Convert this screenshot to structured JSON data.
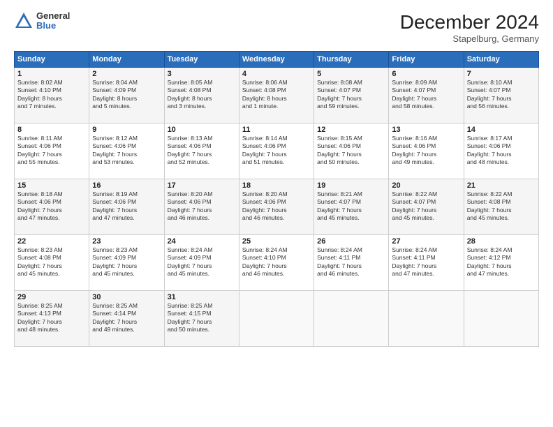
{
  "header": {
    "logo_general": "General",
    "logo_blue": "Blue",
    "title": "December 2024",
    "location": "Stapelburg, Germany"
  },
  "days_of_week": [
    "Sunday",
    "Monday",
    "Tuesday",
    "Wednesday",
    "Thursday",
    "Friday",
    "Saturday"
  ],
  "weeks": [
    [
      {
        "day": "1",
        "detail": "Sunrise: 8:02 AM\nSunset: 4:10 PM\nDaylight: 8 hours\nand 7 minutes."
      },
      {
        "day": "2",
        "detail": "Sunrise: 8:04 AM\nSunset: 4:09 PM\nDaylight: 8 hours\nand 5 minutes."
      },
      {
        "day": "3",
        "detail": "Sunrise: 8:05 AM\nSunset: 4:08 PM\nDaylight: 8 hours\nand 3 minutes."
      },
      {
        "day": "4",
        "detail": "Sunrise: 8:06 AM\nSunset: 4:08 PM\nDaylight: 8 hours\nand 1 minute."
      },
      {
        "day": "5",
        "detail": "Sunrise: 8:08 AM\nSunset: 4:07 PM\nDaylight: 7 hours\nand 59 minutes."
      },
      {
        "day": "6",
        "detail": "Sunrise: 8:09 AM\nSunset: 4:07 PM\nDaylight: 7 hours\nand 58 minutes."
      },
      {
        "day": "7",
        "detail": "Sunrise: 8:10 AM\nSunset: 4:07 PM\nDaylight: 7 hours\nand 56 minutes."
      }
    ],
    [
      {
        "day": "8",
        "detail": "Sunrise: 8:11 AM\nSunset: 4:06 PM\nDaylight: 7 hours\nand 55 minutes."
      },
      {
        "day": "9",
        "detail": "Sunrise: 8:12 AM\nSunset: 4:06 PM\nDaylight: 7 hours\nand 53 minutes."
      },
      {
        "day": "10",
        "detail": "Sunrise: 8:13 AM\nSunset: 4:06 PM\nDaylight: 7 hours\nand 52 minutes."
      },
      {
        "day": "11",
        "detail": "Sunrise: 8:14 AM\nSunset: 4:06 PM\nDaylight: 7 hours\nand 51 minutes."
      },
      {
        "day": "12",
        "detail": "Sunrise: 8:15 AM\nSunset: 4:06 PM\nDaylight: 7 hours\nand 50 minutes."
      },
      {
        "day": "13",
        "detail": "Sunrise: 8:16 AM\nSunset: 4:06 PM\nDaylight: 7 hours\nand 49 minutes."
      },
      {
        "day": "14",
        "detail": "Sunrise: 8:17 AM\nSunset: 4:06 PM\nDaylight: 7 hours\nand 48 minutes."
      }
    ],
    [
      {
        "day": "15",
        "detail": "Sunrise: 8:18 AM\nSunset: 4:06 PM\nDaylight: 7 hours\nand 47 minutes."
      },
      {
        "day": "16",
        "detail": "Sunrise: 8:19 AM\nSunset: 4:06 PM\nDaylight: 7 hours\nand 47 minutes."
      },
      {
        "day": "17",
        "detail": "Sunrise: 8:20 AM\nSunset: 4:06 PM\nDaylight: 7 hours\nand 46 minutes."
      },
      {
        "day": "18",
        "detail": "Sunrise: 8:20 AM\nSunset: 4:06 PM\nDaylight: 7 hours\nand 46 minutes."
      },
      {
        "day": "19",
        "detail": "Sunrise: 8:21 AM\nSunset: 4:07 PM\nDaylight: 7 hours\nand 45 minutes."
      },
      {
        "day": "20",
        "detail": "Sunrise: 8:22 AM\nSunset: 4:07 PM\nDaylight: 7 hours\nand 45 minutes."
      },
      {
        "day": "21",
        "detail": "Sunrise: 8:22 AM\nSunset: 4:08 PM\nDaylight: 7 hours\nand 45 minutes."
      }
    ],
    [
      {
        "day": "22",
        "detail": "Sunrise: 8:23 AM\nSunset: 4:08 PM\nDaylight: 7 hours\nand 45 minutes."
      },
      {
        "day": "23",
        "detail": "Sunrise: 8:23 AM\nSunset: 4:09 PM\nDaylight: 7 hours\nand 45 minutes."
      },
      {
        "day": "24",
        "detail": "Sunrise: 8:24 AM\nSunset: 4:09 PM\nDaylight: 7 hours\nand 45 minutes."
      },
      {
        "day": "25",
        "detail": "Sunrise: 8:24 AM\nSunset: 4:10 PM\nDaylight: 7 hours\nand 46 minutes."
      },
      {
        "day": "26",
        "detail": "Sunrise: 8:24 AM\nSunset: 4:11 PM\nDaylight: 7 hours\nand 46 minutes."
      },
      {
        "day": "27",
        "detail": "Sunrise: 8:24 AM\nSunset: 4:11 PM\nDaylight: 7 hours\nand 47 minutes."
      },
      {
        "day": "28",
        "detail": "Sunrise: 8:24 AM\nSunset: 4:12 PM\nDaylight: 7 hours\nand 47 minutes."
      }
    ],
    [
      {
        "day": "29",
        "detail": "Sunrise: 8:25 AM\nSunset: 4:13 PM\nDaylight: 7 hours\nand 48 minutes."
      },
      {
        "day": "30",
        "detail": "Sunrise: 8:25 AM\nSunset: 4:14 PM\nDaylight: 7 hours\nand 49 minutes."
      },
      {
        "day": "31",
        "detail": "Sunrise: 8:25 AM\nSunset: 4:15 PM\nDaylight: 7 hours\nand 50 minutes."
      },
      {
        "day": "",
        "detail": ""
      },
      {
        "day": "",
        "detail": ""
      },
      {
        "day": "",
        "detail": ""
      },
      {
        "day": "",
        "detail": ""
      }
    ]
  ]
}
